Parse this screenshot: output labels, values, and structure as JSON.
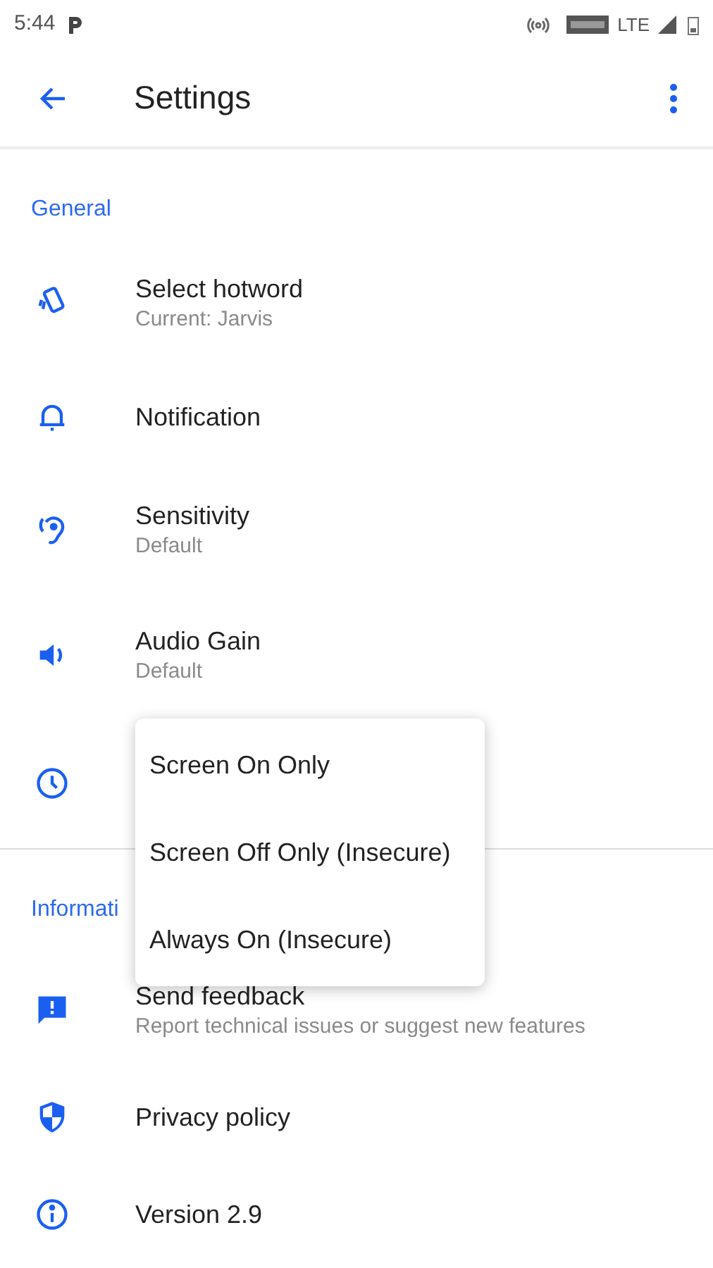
{
  "status_bar": {
    "time": "5:44",
    "network": "LTE"
  },
  "toolbar": {
    "title": "Settings"
  },
  "sections": [
    {
      "header": "General",
      "items": [
        {
          "kind": "setting",
          "title": "Select hotword",
          "subtitle": "Current: Jarvis"
        },
        {
          "kind": "setting",
          "title": "Notification"
        },
        {
          "kind": "setting",
          "title": "Sensitivity",
          "subtitle": "Default"
        },
        {
          "kind": "setting",
          "title": "Audio Gain",
          "subtitle": "Default"
        },
        {
          "kind": "covered"
        }
      ]
    },
    {
      "header": "Informati",
      "items": [
        {
          "kind": "setting",
          "title": "Send feedback",
          "subtitle": "Report technical issues or suggest new features"
        },
        {
          "kind": "setting",
          "title": "Privacy policy"
        },
        {
          "kind": "setting",
          "title": "Version 2.9"
        }
      ]
    }
  ],
  "popup_menu": {
    "items": [
      {
        "label": "Screen On Only"
      },
      {
        "label": "Screen Off Only (Insecure)"
      },
      {
        "label": "Always On (Insecure)"
      }
    ]
  }
}
